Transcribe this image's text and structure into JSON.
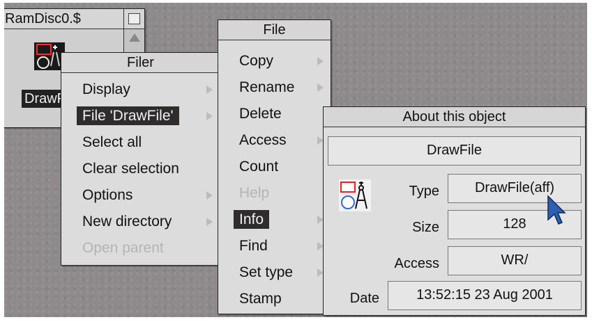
{
  "directory_window": {
    "title": "RamDisc0.$",
    "file_label": "DrawFile"
  },
  "filer_menu": {
    "title": "Filer",
    "items": [
      {
        "label": "Display",
        "submenu": true,
        "enabled": true,
        "selected": false
      },
      {
        "label": "File 'DrawFile'",
        "submenu": true,
        "enabled": true,
        "selected": true
      },
      {
        "label": "Select all",
        "submenu": false,
        "enabled": true,
        "selected": false
      },
      {
        "label": "Clear selection",
        "submenu": false,
        "enabled": true,
        "selected": false
      },
      {
        "label": "Options",
        "submenu": true,
        "enabled": true,
        "selected": false
      },
      {
        "label": "New directory",
        "submenu": true,
        "enabled": true,
        "selected": false
      },
      {
        "label": "Open parent",
        "submenu": false,
        "enabled": false,
        "selected": false
      }
    ]
  },
  "file_menu": {
    "title": "File",
    "items": [
      {
        "label": "Copy",
        "submenu": true,
        "enabled": true,
        "selected": false
      },
      {
        "label": "Rename",
        "submenu": true,
        "enabled": true,
        "selected": false
      },
      {
        "label": "Delete",
        "submenu": false,
        "enabled": true,
        "selected": false
      },
      {
        "label": "Access",
        "submenu": true,
        "enabled": true,
        "selected": false
      },
      {
        "label": "Count",
        "submenu": false,
        "enabled": true,
        "selected": false
      },
      {
        "label": "Help",
        "submenu": false,
        "enabled": false,
        "selected": false
      },
      {
        "label": "Info",
        "submenu": true,
        "enabled": true,
        "selected": true
      },
      {
        "label": "Find",
        "submenu": true,
        "enabled": true,
        "selected": false
      },
      {
        "label": "Set type",
        "submenu": true,
        "enabled": true,
        "selected": false
      },
      {
        "label": "Stamp",
        "submenu": false,
        "enabled": true,
        "selected": false
      }
    ]
  },
  "info_box": {
    "title": "About this object",
    "name": "DrawFile",
    "type_label": "Type",
    "type_value": "DrawFile(aff)",
    "size_label": "Size",
    "size_value": "128",
    "access_label": "Access",
    "access_value": "WR/",
    "date_label": "Date",
    "date_value": "13:52:15 23 Aug 2001",
    "icon": "drawfile-icon"
  },
  "colors": {
    "desktop": "#8e8a8c",
    "menu_bg": "#dcdcdc",
    "selection": "#2f2c2c",
    "pointer": "#2e5fb0"
  }
}
